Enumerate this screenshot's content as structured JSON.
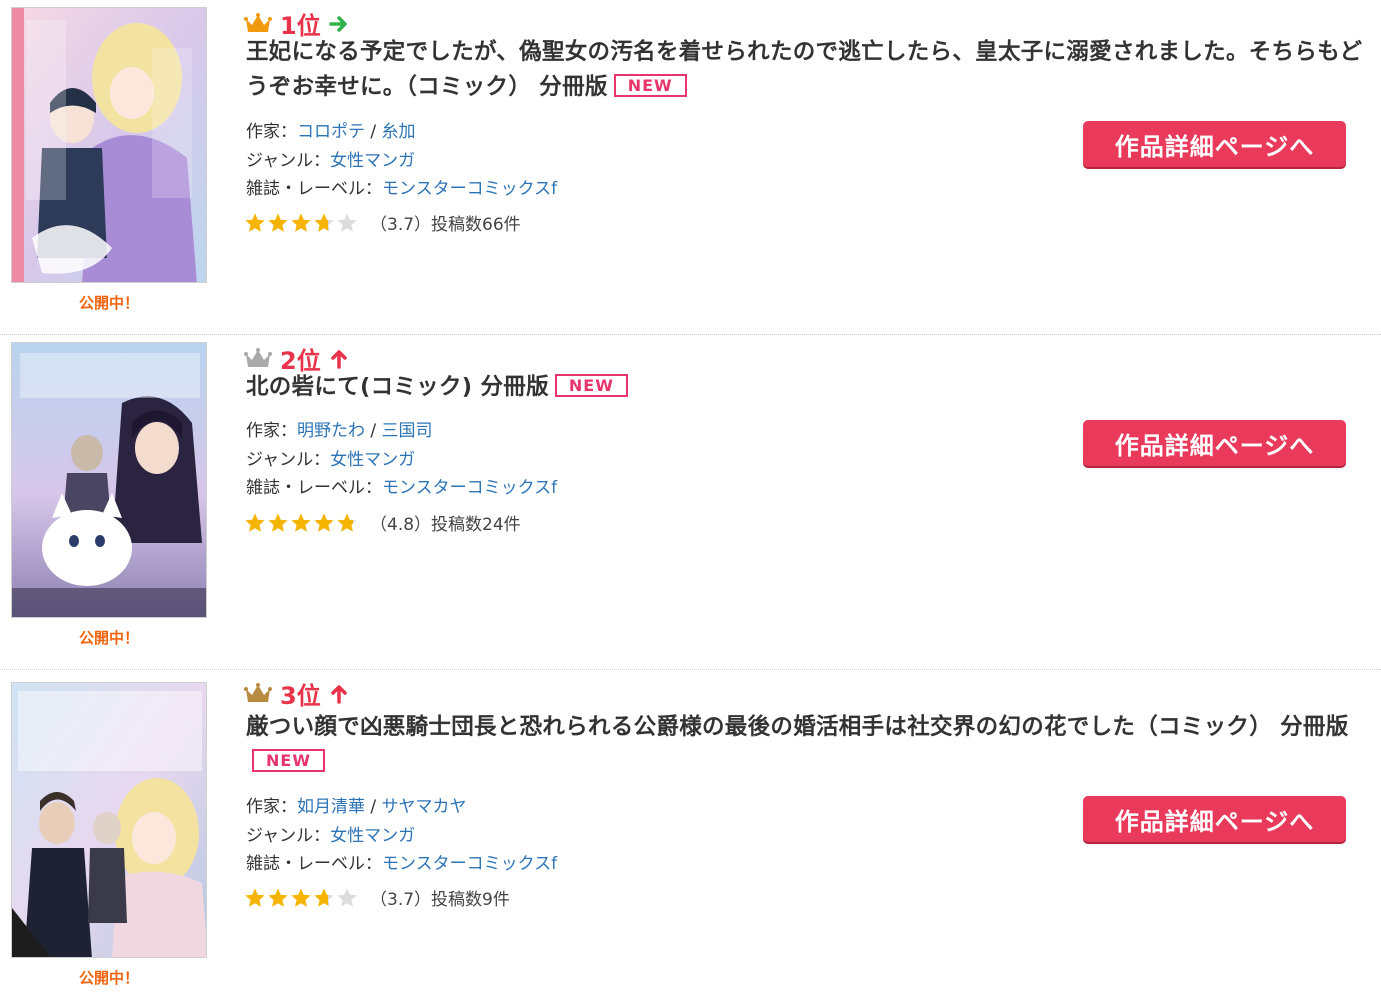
{
  "labels": {
    "author_prefix": "作家：",
    "genre_prefix": "ジャンル：",
    "label_prefix": "雑誌・レーベル：",
    "separator": " / ",
    "status": "公開中！",
    "detail_button": "作品詳細ページへ",
    "new_badge": "NEW"
  },
  "colors": {
    "rank_text": "#e8334a",
    "link": "#2d74b6",
    "button": "#ea3a5b",
    "status": "#f2650f",
    "star": "#f5b400",
    "crown_gold": "#f19a0e",
    "crown_silver": "#a9a9a9",
    "crown_bronze": "#b98b41"
  },
  "items": [
    {
      "rank": "1位",
      "trend": "same",
      "crown": "crown-gold-icon",
      "title": "王妃になる予定でしたが、偽聖女の汚名を着せられたので逃亡したら、皇太子に溺愛されました。そちらもどうぞお幸せに。（コミック） 分冊版",
      "authors": [
        "コロポテ",
        "糸加"
      ],
      "genre": "女性マンガ",
      "label": "モンスターコミックスf",
      "rating": 3.7,
      "rating_text": "（3.7）投稿数66件"
    },
    {
      "rank": "2位",
      "trend": "up",
      "crown": "crown-silver-icon",
      "title": "北の砦にて(コミック) 分冊版",
      "authors": [
        "明野たわ",
        "三国司"
      ],
      "genre": "女性マンガ",
      "label": "モンスターコミックスf",
      "rating": 4.8,
      "rating_text": "（4.8）投稿数24件"
    },
    {
      "rank": "3位",
      "trend": "up",
      "crown": "crown-bronze-icon",
      "title": "厳つい顔で凶悪騎士団長と恐れられる公爵様の最後の婚活相手は社交界の幻の花でした（コミック） 分冊版",
      "authors": [
        "如月清華",
        "サヤマカヤ"
      ],
      "genre": "女性マンガ",
      "label": "モンスターコミックスf",
      "rating": 3.7,
      "rating_text": "（3.7）投稿数9件"
    }
  ]
}
